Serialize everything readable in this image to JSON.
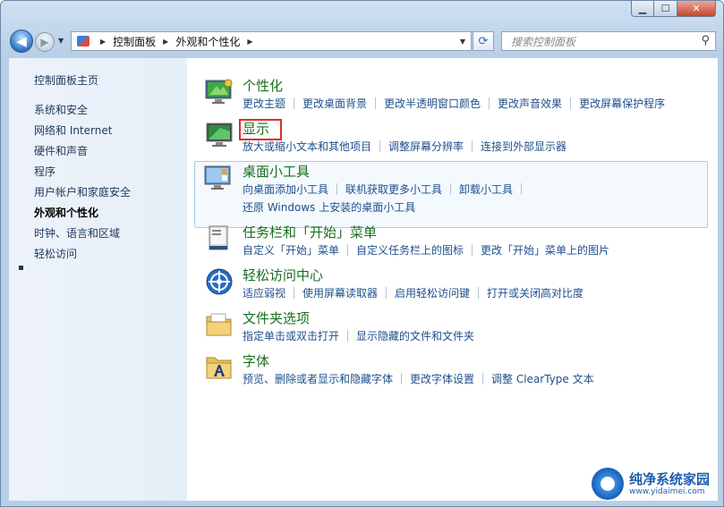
{
  "window": {
    "minimize_glyph": "▁",
    "maximize_glyph": "☐",
    "close_glyph": "✕"
  },
  "nav": {
    "back_glyph": "◀",
    "forward_glyph": "▶",
    "recent_glyph": "▼",
    "breadcrumb": [
      "控制面板",
      "外观和个性化"
    ],
    "separator_glyph": "▶",
    "dropdown_glyph": "▼",
    "refresh_glyph": "⟳",
    "search_placeholder": "搜索控制面板",
    "search_glyph": "⚲"
  },
  "sidebar": {
    "items": [
      {
        "label": "控制面板主页",
        "active": false
      },
      {
        "label": "系统和安全",
        "active": false
      },
      {
        "label": "网络和 Internet",
        "active": false
      },
      {
        "label": "硬件和声音",
        "active": false
      },
      {
        "label": "程序",
        "active": false
      },
      {
        "label": "用户帐户和家庭安全",
        "active": false
      },
      {
        "label": "外观和个性化",
        "active": true
      },
      {
        "label": "时钟、语言和区域",
        "active": false
      },
      {
        "label": "轻松访问",
        "active": false
      }
    ]
  },
  "categories": [
    {
      "title": "个性化",
      "icon": "personalization-icon",
      "links": [
        "更改主题",
        "更改桌面背景",
        "更改半透明窗口颜色",
        "更改声音效果",
        "更改屏幕保护程序"
      ]
    },
    {
      "title": "显示",
      "icon": "display-icon",
      "links": [
        "放大或缩小文本和其他项目",
        "调整屏幕分辨率",
        "连接到外部显示器"
      ]
    },
    {
      "title": "桌面小工具",
      "icon": "gadgets-icon",
      "links": [
        "向桌面添加小工具",
        "联机获取更多小工具",
        "卸载小工具"
      ],
      "links2": "还原 Windows 上安装的桌面小工具"
    },
    {
      "title": "任务栏和「开始」菜单",
      "icon": "taskbar-icon",
      "links": [
        "自定义「开始」菜单",
        "自定义任务栏上的图标",
        "更改「开始」菜单上的图片"
      ]
    },
    {
      "title": "轻松访问中心",
      "icon": "ease-of-access-icon",
      "links": [
        "适应弱视",
        "使用屏幕读取器",
        "启用轻松访问键",
        "打开或关闭高对比度"
      ]
    },
    {
      "title": "文件夹选项",
      "icon": "folder-options-icon",
      "links": [
        "指定单击或双击打开",
        "显示隐藏的文件和文件夹"
      ]
    },
    {
      "title": "字体",
      "icon": "fonts-icon",
      "links": [
        "预览、删除或者显示和隐藏字体",
        "更改字体设置",
        "调整 ClearType 文本"
      ]
    }
  ],
  "watermark": {
    "title": "纯净系统家园",
    "url": "www.yidaimei.com"
  },
  "colors": {
    "category_title": "#1a6e1e",
    "link": "#1e4f8c",
    "highlight_border": "#e02a2a"
  }
}
